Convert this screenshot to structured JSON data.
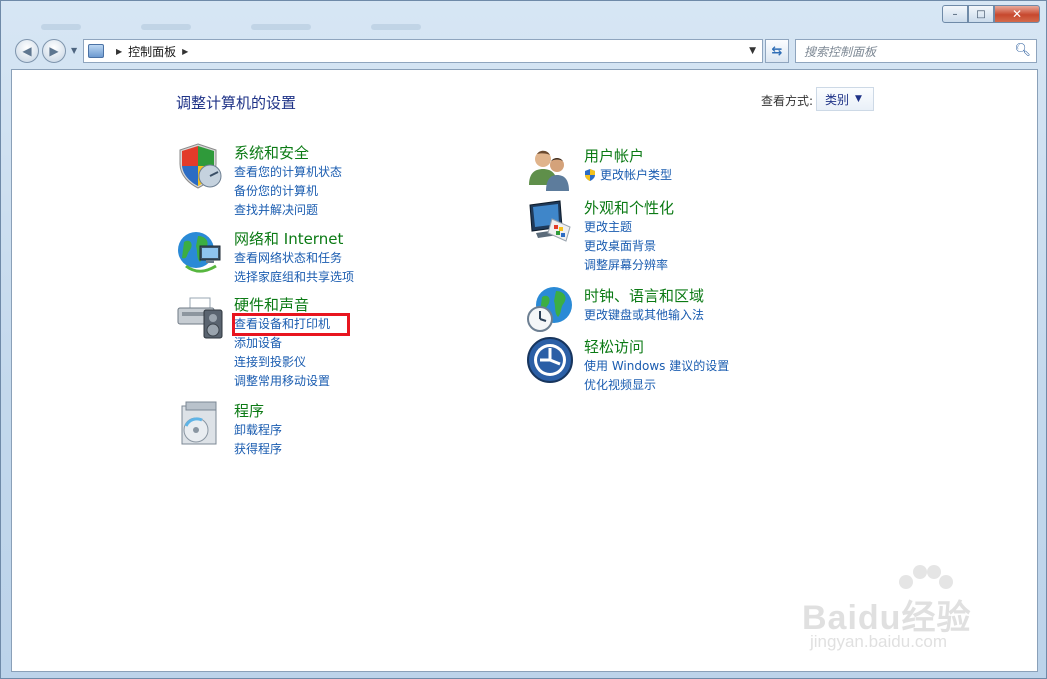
{
  "window": {
    "minimize": "–",
    "maximize": "□",
    "close": "✕"
  },
  "nav": {
    "breadcrumb": "控制面板",
    "search_placeholder": "搜索控制面板"
  },
  "main": {
    "heading": "调整计算机的设置",
    "view_by_label": "查看方式:",
    "view_by_value": "类别"
  },
  "categories": {
    "system": {
      "title": "系统和安全",
      "links": [
        "查看您的计算机状态",
        "备份您的计算机",
        "查找并解决问题"
      ]
    },
    "network": {
      "title": "网络和 Internet",
      "links": [
        "查看网络状态和任务",
        "选择家庭组和共享选项"
      ]
    },
    "hardware": {
      "title": "硬件和声音",
      "links": [
        "查看设备和打印机",
        "添加设备",
        "连接到投影仪",
        "调整常用移动设置"
      ]
    },
    "programs": {
      "title": "程序",
      "links": [
        "卸载程序",
        "获得程序"
      ]
    },
    "accounts": {
      "title": "用户帐户",
      "links": [
        "更改帐户类型"
      ]
    },
    "appearance": {
      "title": "外观和个性化",
      "links": [
        "更改主题",
        "更改桌面背景",
        "调整屏幕分辨率"
      ]
    },
    "clock": {
      "title": "时钟、语言和区域",
      "links": [
        "更改键盘或其他输入法"
      ]
    },
    "ease": {
      "title": "轻松访问",
      "links": [
        "使用 Windows 建议的设置",
        "优化视频显示"
      ]
    }
  },
  "watermark": {
    "brand": "Baidu经验",
    "url": "jingyan.baidu.com"
  },
  "colors": {
    "category_title": "#0b7a14",
    "link": "#1a5cb0",
    "heading": "#1e3287",
    "highlight": "#e8151f"
  }
}
